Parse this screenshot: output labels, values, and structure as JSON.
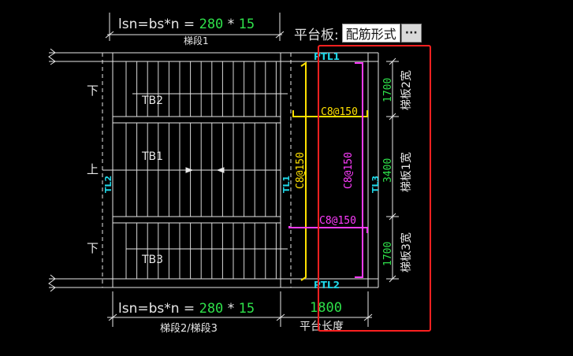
{
  "top_formula": {
    "prefix": "lsn=bs*n = ",
    "bs": "280",
    "star": "*",
    "n": "15",
    "caption": "梯段1"
  },
  "bottom_formula": {
    "prefix": "lsn=bs*n = ",
    "bs": "280",
    "star": "*",
    "n": "15",
    "caption": "梯段2/梯段3"
  },
  "platform_control": {
    "label": "平台板:",
    "value": "配筋形式",
    "more": "···"
  },
  "platform_length": {
    "value": "1800",
    "caption": "平台长度"
  },
  "beam_labels": {
    "ptl_top": "PTL1",
    "ptl_bottom": "PTL2",
    "tl1": "TL1",
    "tl2": "TL2",
    "tl3": "TL3"
  },
  "flight_labels": {
    "tb1": "TB1",
    "tb2": "TB2",
    "tb3": "TB3"
  },
  "direction_labels": {
    "down_top": "下",
    "up": "上",
    "down_bottom": "下"
  },
  "rebar_labels": {
    "top_h": "C8@150",
    "bottom_h": "C8@150",
    "vertical_yellow": "C8@150",
    "vertical_magenta": "C8@150"
  },
  "right_dimensions": [
    {
      "value": "1700",
      "caption": "梯板2宽"
    },
    {
      "value": "3400",
      "caption": "梯板1宽"
    },
    {
      "value": "1700",
      "caption": "梯板3宽"
    }
  ],
  "colors": {
    "background": "#000000",
    "lines": "#e8e8e8",
    "dimension_numbers": "#2ee04a",
    "beam_labels": "#1fd6e6",
    "rebar_yellow": "#ffe000",
    "rebar_magenta": "#ff3cff",
    "highlight_box": "#ff2020"
  }
}
